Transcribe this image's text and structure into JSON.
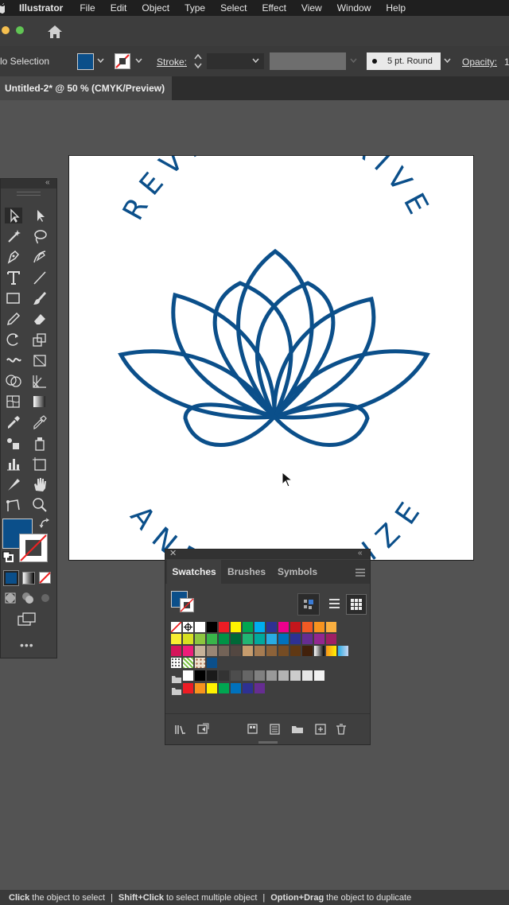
{
  "menubar": {
    "app": "Illustrator",
    "items": [
      "File",
      "Edit",
      "Object",
      "Type",
      "Select",
      "Effect",
      "View",
      "Window",
      "Help"
    ]
  },
  "controlbar": {
    "selection": "lo Selection",
    "fill_color": "#0b4f8a",
    "stroke_label": "Stroke:",
    "brush": "5 pt. Round",
    "opacity_label": "Opacity:",
    "opacity_value": "1"
  },
  "document": {
    "tab_title": "Untitled-2* @ 50 % (CMYK/Preview)"
  },
  "artwork": {
    "top_text": "REVIVE, THRIVE",
    "bottom_text": "AND OPTIMIZE",
    "ink_color": "#0b4f8a"
  },
  "swatches_panel": {
    "tabs": [
      "Swatches",
      "Brushes",
      "Symbols"
    ],
    "active_tab": "Swatches",
    "rows": [
      [
        "none",
        "registration",
        "#ffffff",
        "#000000",
        "#ed1c24",
        "#fff200",
        "#00a651",
        "#00aeef",
        "#2e3192",
        "#ec008c",
        "#c4161c",
        "#f15a24",
        "#f7931e",
        "#fbb040"
      ],
      [
        "#f9ed32",
        "#d7e021",
        "#8dc63f",
        "#39b54a",
        "#009245",
        "#006837",
        "#22b573",
        "#00a99d",
        "#29abe2",
        "#0071bc",
        "#2e3192",
        "#662d91",
        "#93278f",
        "#9e1f63"
      ],
      [
        "#d4145a",
        "#ed1e79",
        "#c7b299",
        "#998675",
        "#736357",
        "#534741",
        "#c69c6d",
        "#a67c52",
        "#8c6239",
        "#754c24",
        "#603813",
        "#42210b",
        "gradient-bw",
        "gradient-orange",
        "gradient-blue"
      ]
    ],
    "pattern_row": [
      "pattern-dots",
      "pattern-leaf",
      "pattern-floral",
      "#0b4f8a"
    ],
    "gray_group": [
      "#ffffff",
      "#000000",
      "#1a1a1a",
      "#333333",
      "#4d4d4d",
      "#666666",
      "#808080",
      "#999999",
      "#b3b3b3",
      "#cccccc",
      "#e6e6e6",
      "#f2f2f2"
    ],
    "bright_group": [
      "#ed1c24",
      "#f7931e",
      "#fff200",
      "#00a651",
      "#0071bc",
      "#2e3192",
      "#662d91"
    ]
  },
  "statusbar": {
    "part1_bold": "Click",
    "part1": "the object to select",
    "part2_bold": "Shift+Click",
    "part2": "to select multiple object",
    "part3_bold": "Option+Drag",
    "part3": "the object to duplicate"
  }
}
